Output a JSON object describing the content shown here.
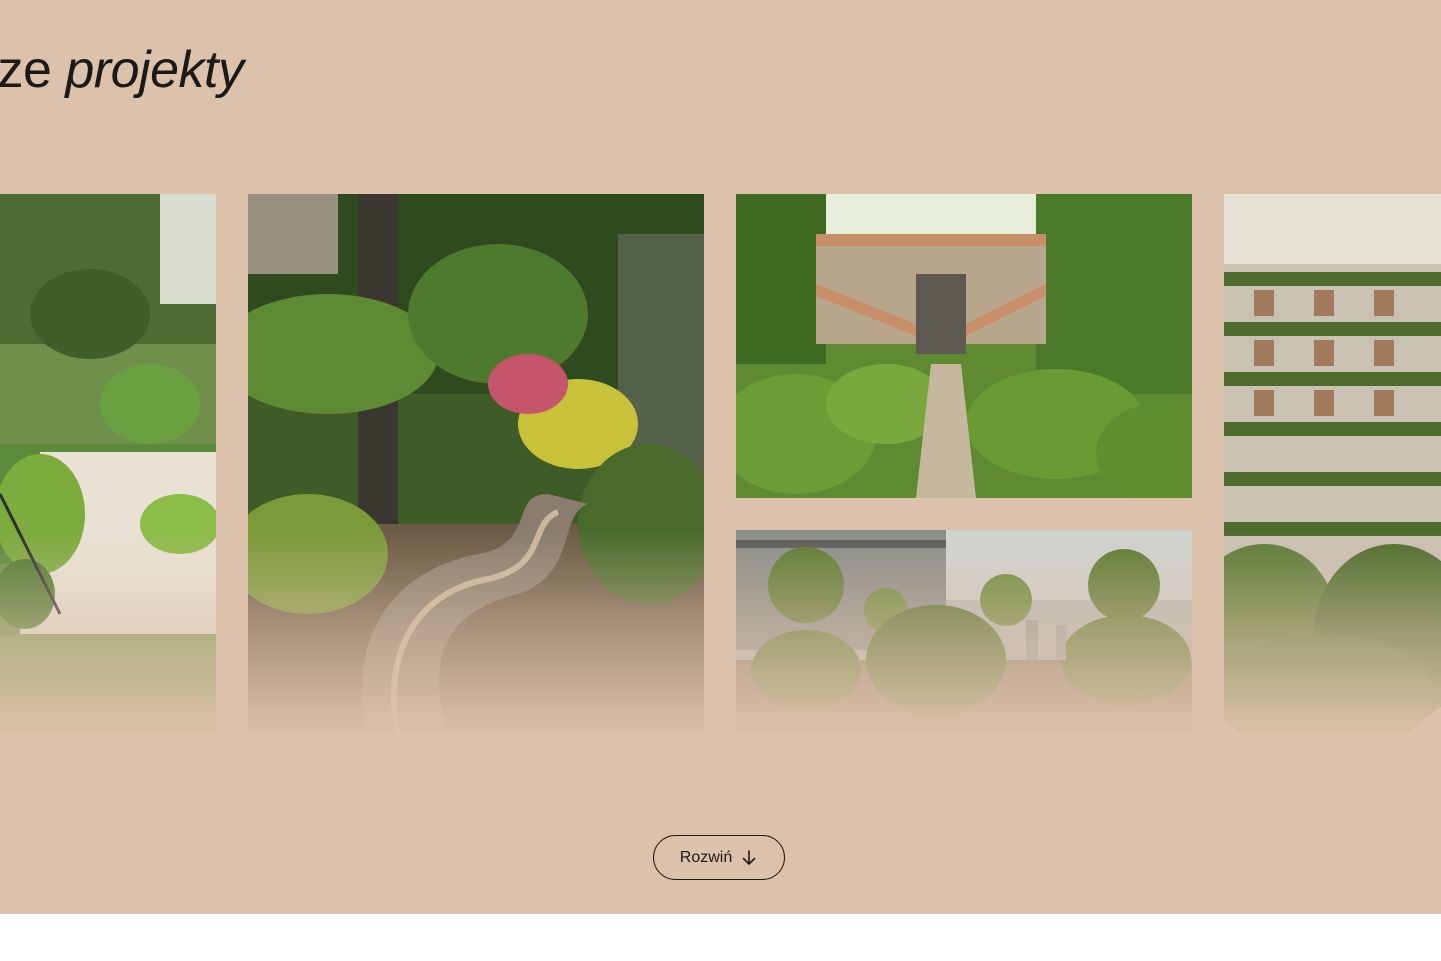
{
  "section": {
    "background": "#dcc2aa",
    "heading_plain": "sze ",
    "heading_italic": "projekty"
  },
  "gallery": {
    "tiles": [
      {
        "name": "tropical-garden-terrace-photo",
        "icon": "photo"
      },
      {
        "name": "jungle-gravel-path-photo",
        "icon": "photo"
      },
      {
        "name": "baroque-hedge-garden-photo",
        "icon": "photo"
      },
      {
        "name": "rooftop-topiary-photo",
        "icon": "photo"
      },
      {
        "name": "green-terraced-building-photo",
        "icon": "photo"
      }
    ]
  },
  "expand_button": {
    "label": "Rozwiń",
    "icon": "arrow-down-icon"
  },
  "colors": {
    "accent_text": "#1c1a18",
    "section_bg": "#dcc2aa",
    "page_bg": "#ffffff"
  }
}
